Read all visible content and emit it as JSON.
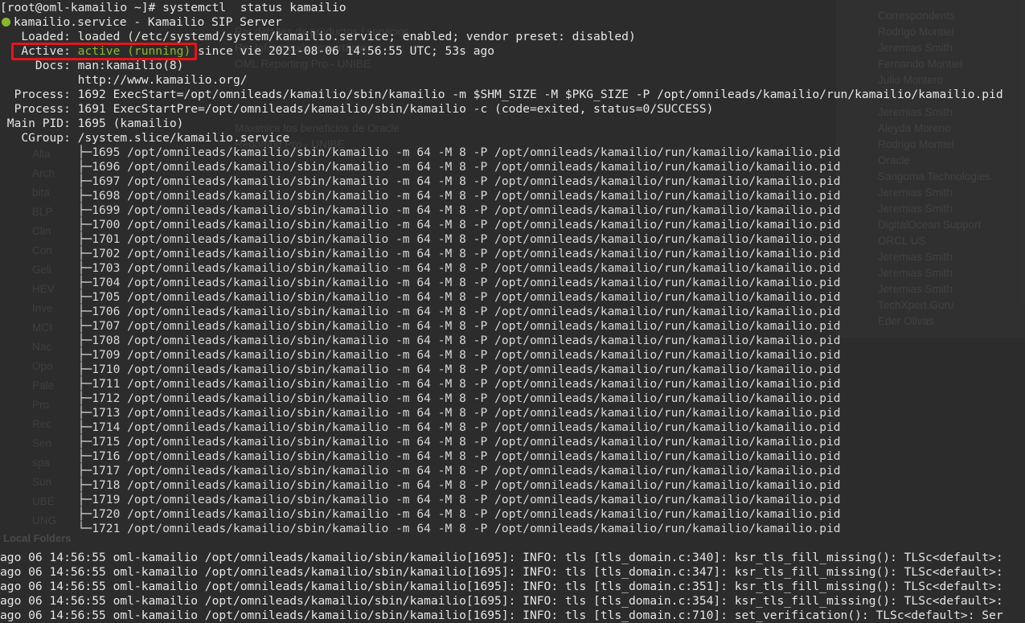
{
  "prompt_line": "[root@oml-kamailio ~]# systemctl  status kamailio",
  "service_line": "kamailio.service - Kamailio SIP Server",
  "loaded_line": "   Loaded: loaded (/etc/systemd/system/kamailio.service; enabled; vendor preset: disabled)",
  "active_prefix": "   Active: ",
  "active_status": "active (running)",
  "active_suffix": " since vie 2021-08-06 14:56:55 UTC; 53s ago",
  "docs_line": "     Docs: man:kamailio(8)",
  "docs_url_line": "           http://www.kamailio.org/",
  "process1_line": "  Process: 1692 ExecStart=/opt/omnileads/kamailio/sbin/kamailio -m $SHM_SIZE -M $PKG_SIZE -P /opt/omnileads/kamailio/run/kamailio/kamailio.pid",
  "process2_line": "  Process: 1691 ExecStartPre=/opt/omnileads/kamailio/sbin/kamailio -c (code=exited, status=0/SUCCESS)",
  "mainpid_line": " Main PID: 1695 (kamailio)",
  "cgroup_line": "   CGroup: /system.slice/kamailio.service",
  "cgroup_items": [
    "           ├─1695 /opt/omnileads/kamailio/sbin/kamailio -m 64 -M 8 -P /opt/omnileads/kamailio/run/kamailio/kamailio.pid",
    "           ├─1696 /opt/omnileads/kamailio/sbin/kamailio -m 64 -M 8 -P /opt/omnileads/kamailio/run/kamailio/kamailio.pid",
    "           ├─1697 /opt/omnileads/kamailio/sbin/kamailio -m 64 -M 8 -P /opt/omnileads/kamailio/run/kamailio/kamailio.pid",
    "           ├─1698 /opt/omnileads/kamailio/sbin/kamailio -m 64 -M 8 -P /opt/omnileads/kamailio/run/kamailio/kamailio.pid",
    "           ├─1699 /opt/omnileads/kamailio/sbin/kamailio -m 64 -M 8 -P /opt/omnileads/kamailio/run/kamailio/kamailio.pid",
    "           ├─1700 /opt/omnileads/kamailio/sbin/kamailio -m 64 -M 8 -P /opt/omnileads/kamailio/run/kamailio/kamailio.pid",
    "           ├─1701 /opt/omnileads/kamailio/sbin/kamailio -m 64 -M 8 -P /opt/omnileads/kamailio/run/kamailio/kamailio.pid",
    "           ├─1702 /opt/omnileads/kamailio/sbin/kamailio -m 64 -M 8 -P /opt/omnileads/kamailio/run/kamailio/kamailio.pid",
    "           ├─1703 /opt/omnileads/kamailio/sbin/kamailio -m 64 -M 8 -P /opt/omnileads/kamailio/run/kamailio/kamailio.pid",
    "           ├─1704 /opt/omnileads/kamailio/sbin/kamailio -m 64 -M 8 -P /opt/omnileads/kamailio/run/kamailio/kamailio.pid",
    "           ├─1705 /opt/omnileads/kamailio/sbin/kamailio -m 64 -M 8 -P /opt/omnileads/kamailio/run/kamailio/kamailio.pid",
    "           ├─1706 /opt/omnileads/kamailio/sbin/kamailio -m 64 -M 8 -P /opt/omnileads/kamailio/run/kamailio/kamailio.pid",
    "           ├─1707 /opt/omnileads/kamailio/sbin/kamailio -m 64 -M 8 -P /opt/omnileads/kamailio/run/kamailio/kamailio.pid",
    "           ├─1708 /opt/omnileads/kamailio/sbin/kamailio -m 64 -M 8 -P /opt/omnileads/kamailio/run/kamailio/kamailio.pid",
    "           ├─1709 /opt/omnileads/kamailio/sbin/kamailio -m 64 -M 8 -P /opt/omnileads/kamailio/run/kamailio/kamailio.pid",
    "           ├─1710 /opt/omnileads/kamailio/sbin/kamailio -m 64 -M 8 -P /opt/omnileads/kamailio/run/kamailio/kamailio.pid",
    "           ├─1711 /opt/omnileads/kamailio/sbin/kamailio -m 64 -M 8 -P /opt/omnileads/kamailio/run/kamailio/kamailio.pid",
    "           ├─1712 /opt/omnileads/kamailio/sbin/kamailio -m 64 -M 8 -P /opt/omnileads/kamailio/run/kamailio/kamailio.pid",
    "           ├─1713 /opt/omnileads/kamailio/sbin/kamailio -m 64 -M 8 -P /opt/omnileads/kamailio/run/kamailio/kamailio.pid",
    "           ├─1714 /opt/omnileads/kamailio/sbin/kamailio -m 64 -M 8 -P /opt/omnileads/kamailio/run/kamailio/kamailio.pid",
    "           ├─1715 /opt/omnileads/kamailio/sbin/kamailio -m 64 -M 8 -P /opt/omnileads/kamailio/run/kamailio/kamailio.pid",
    "           ├─1716 /opt/omnileads/kamailio/sbin/kamailio -m 64 -M 8 -P /opt/omnileads/kamailio/run/kamailio/kamailio.pid",
    "           ├─1717 /opt/omnileads/kamailio/sbin/kamailio -m 64 -M 8 -P /opt/omnileads/kamailio/run/kamailio/kamailio.pid",
    "           ├─1718 /opt/omnileads/kamailio/sbin/kamailio -m 64 -M 8 -P /opt/omnileads/kamailio/run/kamailio/kamailio.pid",
    "           ├─1719 /opt/omnileads/kamailio/sbin/kamailio -m 64 -M 8 -P /opt/omnileads/kamailio/run/kamailio/kamailio.pid",
    "           ├─1720 /opt/omnileads/kamailio/sbin/kamailio -m 64 -M 8 -P /opt/omnileads/kamailio/run/kamailio/kamailio.pid",
    "           └─1721 /opt/omnileads/kamailio/sbin/kamailio -m 64 -M 8 -P /opt/omnileads/kamailio/run/kamailio/kamailio.pid"
  ],
  "log_lines": [
    "ago 06 14:56:55 oml-kamailio /opt/omnileads/kamailio/sbin/kamailio[1695]: INFO: tls [tls_domain.c:340]: ksr_tls_fill_missing(): TLSc<default>:",
    "ago 06 14:56:55 oml-kamailio /opt/omnileads/kamailio/sbin/kamailio[1695]: INFO: tls [tls_domain.c:347]: ksr_tls_fill_missing(): TLSc<default>:",
    "ago 06 14:56:55 oml-kamailio /opt/omnileads/kamailio/sbin/kamailio[1695]: INFO: tls [tls_domain.c:351]: ksr_tls_fill_missing(): TLSc<default>:",
    "ago 06 14:56:55 oml-kamailio /opt/omnileads/kamailio/sbin/kamailio[1695]: INFO: tls [tls_domain.c:354]: ksr_tls_fill_missing(): TLSc<default>:",
    "ago 06 14:56:55 oml-kamailio /opt/omnileads/kamailio/sbin/kamailio[1695]: INFO: tls [tls_domain.c:710]: set_verification(): TLSc<default>: Ser"
  ],
  "background_window": {
    "correspondents_header": "Correspondents",
    "correspondents": [
      "Rodrigo Montiel",
      "Jeremias Smith",
      "Fernando Montiel",
      "Julio Montero",
      "",
      "Jeremias Smith",
      "Aleyda Moreno",
      "Rodrigo Montiel",
      "Oracle",
      "Sangoma Technologies",
      "Jeremias Smith",
      "Jeremias Smith",
      "DigitalOcean Support",
      "ORCL US",
      "Jeremias Smith",
      "Jeremias Smith",
      "Jeremias Smith",
      "TechXpert.Guru",
      "Eder Olivas"
    ],
    "subjects": [
      "Re: detalles de productos / servicios",
      "Re: Información Importante",
      "OML Reporting Pro - UNIBE",
      "",
      "",
      "",
      "Maximice los beneficios de Oracle",
      "Reporting Pro - UNIBE"
    ],
    "folders": [
      "Alla",
      "Arch",
      "bita",
      "BLP",
      "Clin",
      "Con",
      "Geli",
      "HEV",
      "Inve",
      "MCI",
      "Nac",
      "Opo",
      "Pale",
      "Pro",
      "Rec",
      "Sen",
      "spa",
      "Sun",
      "UBE",
      "UNG"
    ],
    "local_folders_label": "Local Folders"
  },
  "colors": {
    "background": "#2c2c2c",
    "text": "#e6e6e6",
    "running": "#8ab82d",
    "highlight_box": "#e8141a"
  }
}
